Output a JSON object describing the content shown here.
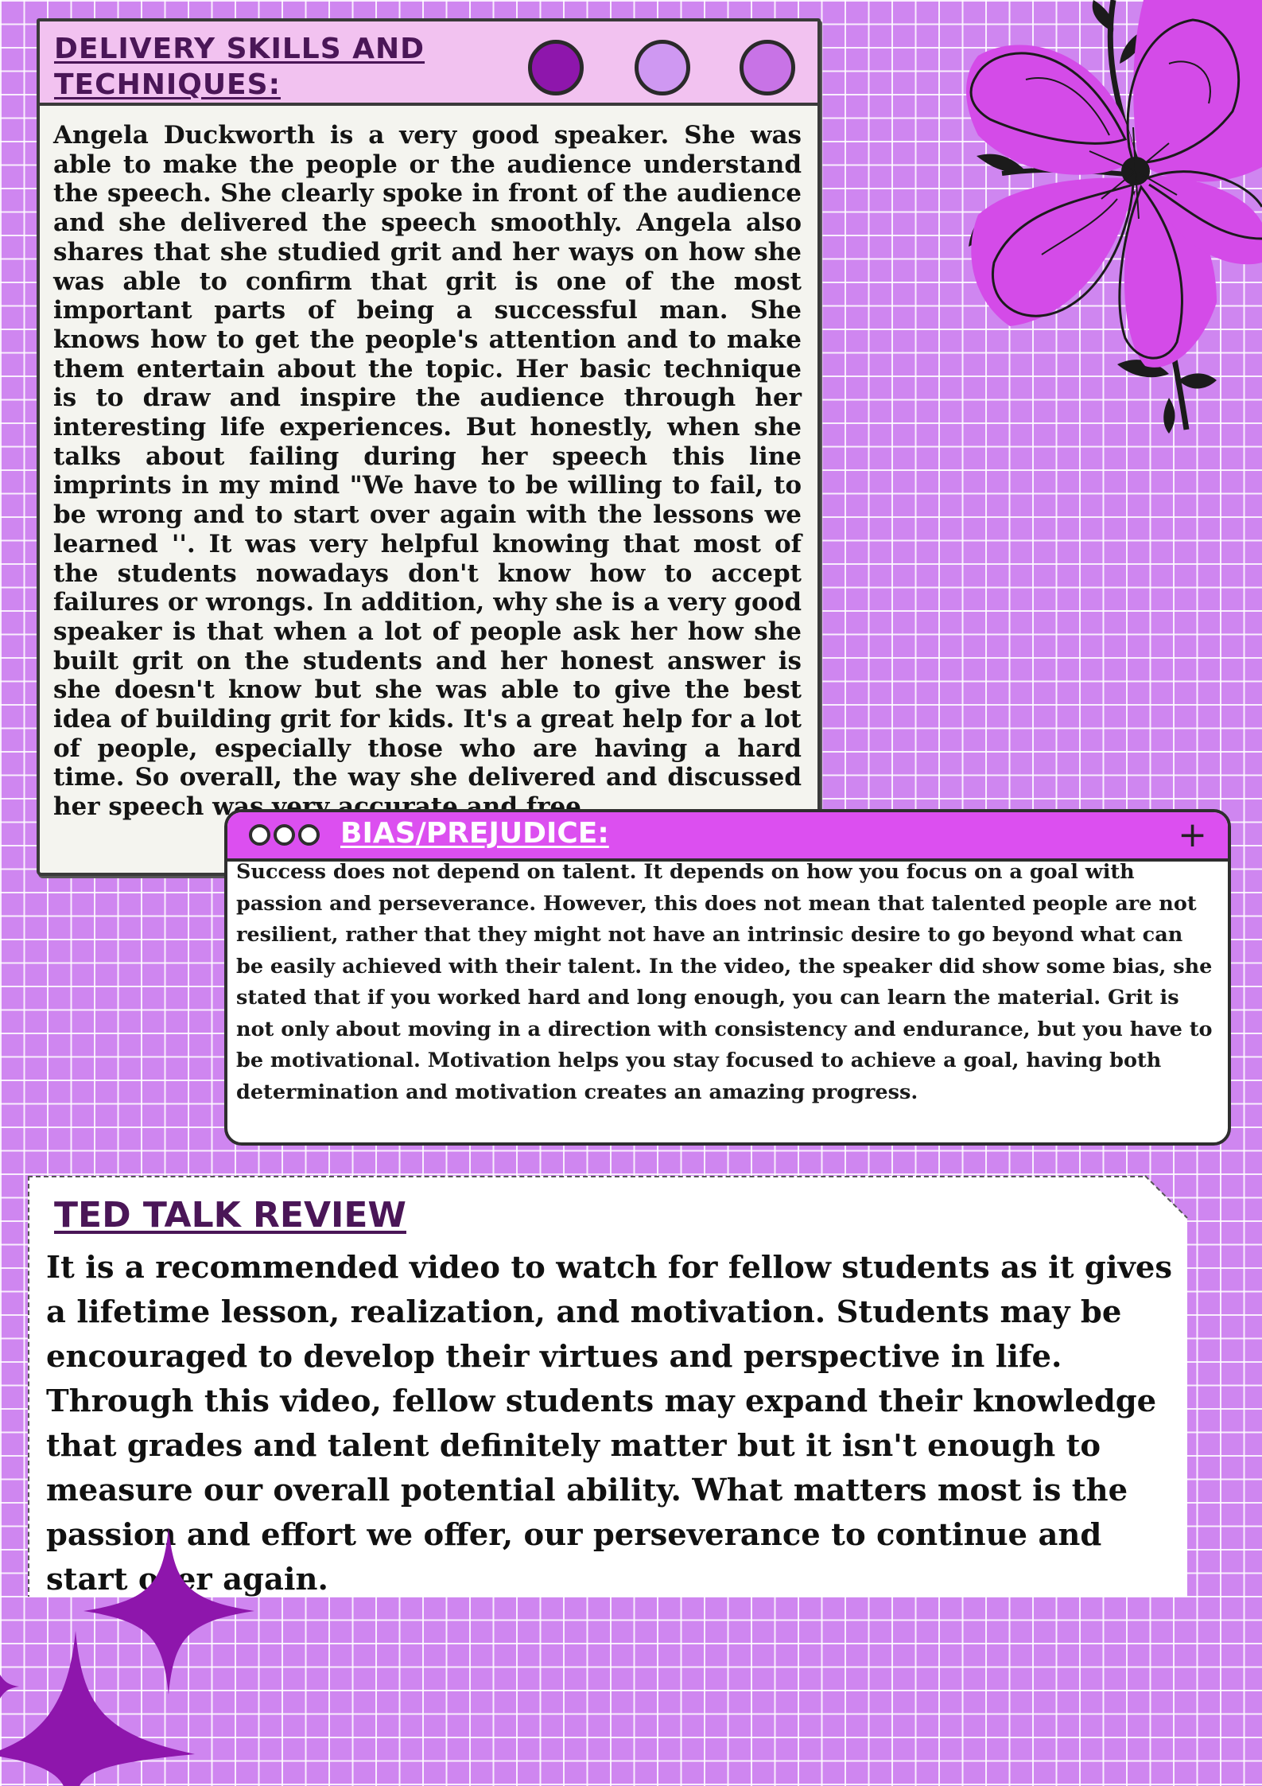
{
  "delivery": {
    "title": "DELIVERY SKILLS AND TECHNIQUES:",
    "body": "Angela Duckworth is a very good speaker. She was able to make the people or the audience understand the speech. She clearly spoke in front of the audience and she delivered the speech smoothly. Angela also shares that she studied grit and her ways on how she was able to confirm that grit is one of the most important parts of being a successful man. She knows how to get the people's attention and to make them entertain about the topic. Her basic technique is to draw and inspire the audience through her interesting life experiences. But honestly, when she talks about failing during her speech this line imprints in my mind \"We have to be willing to fail, to be wrong and to start over again with the lessons we learned ''. It was very helpful knowing that most of the students nowadays don't know how to accept failures or wrongs. In addition, why she is a very good speaker is that when a lot of people ask her how she built grit on the students and her honest answer is she doesn't know but she was able to give the best idea of building grit for kids. It's a great help for a lot of people, especially those who are having a hard time. So overall, the way she delivered and discussed her speech was very accurate and free."
  },
  "bias": {
    "title": "BIAS/PREJUDICE:",
    "plus": "+",
    "body": "Success does not depend on talent. It depends on how you focus on a goal with passion and perseverance. However, this does not mean that talented people are not resilient, rather that they might not have an intrinsic desire to go beyond what can be easily achieved with their talent. In the video, the speaker did show some bias, she stated that if you worked hard and long enough, you can learn the material. Grit is not only about moving in a direction with consistency and endurance, but you have to be motivational. Motivation helps you stay focused to achieve a goal, having both determination and motivation creates an amazing progress."
  },
  "ted": {
    "title": "TED TALK REVIEW",
    "body": "It is a recommended video to watch for fellow students as it gives a lifetime lesson, realization, and motivation. Students may be encouraged to develop their virtues and perspective in life. Through this video, fellow students may expand their knowledge that grades and talent definitely matter but it isn't enough to measure our overall potential ability.  What matters  most is the passion and effort we offer, our perseverance to continue and start over again."
  },
  "colors": {
    "background": "#cf86f0",
    "grid": "#ffffff",
    "accent_purple": "#8e16ac",
    "title_text": "#4a1657",
    "bias_bar": "#dc4ff0",
    "delivery_bar": "#f2c2f0",
    "flower": "#d44be8"
  },
  "icons": {
    "decor_flower": "flower-icon",
    "decor_star": "sparkle-icon",
    "window_dot": "circle-icon",
    "add": "plus-icon"
  }
}
